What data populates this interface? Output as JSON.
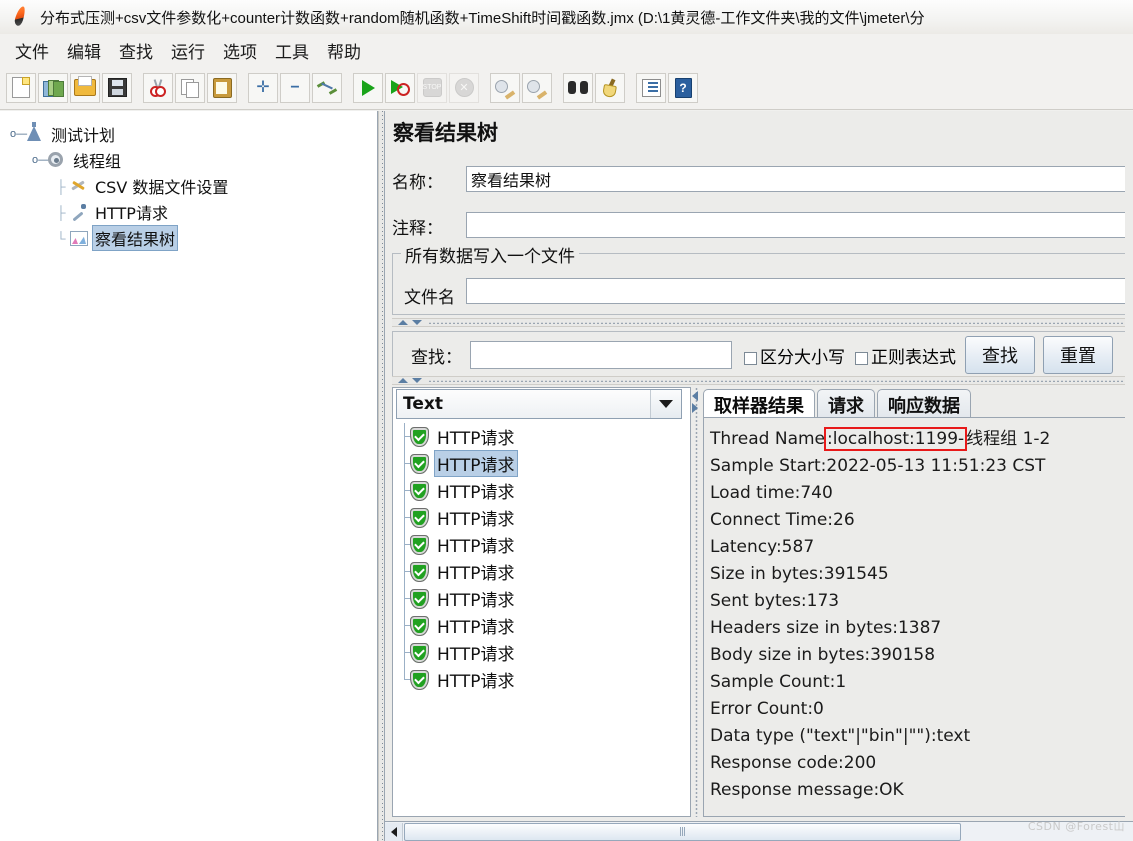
{
  "window": {
    "title": "分布式压测+csv文件参数化+counter计数函数+random随机函数+TimeShift时间戳函数.jmx (D:\\1黄灵德-工作文件夹\\我的文件\\jmeter\\分",
    "app_icon": "jmeter-feather-icon"
  },
  "menubar": {
    "items": [
      {
        "label": "文件",
        "name": "menu-file"
      },
      {
        "label": "编辑",
        "name": "menu-edit"
      },
      {
        "label": "查找",
        "name": "menu-search"
      },
      {
        "label": "运行",
        "name": "menu-run"
      },
      {
        "label": "选项",
        "name": "menu-options"
      },
      {
        "label": "工具",
        "name": "menu-tools"
      },
      {
        "label": "帮助",
        "name": "menu-help"
      }
    ]
  },
  "toolbar": {
    "buttons": [
      {
        "name": "new-icon"
      },
      {
        "name": "templates-icon"
      },
      {
        "name": "open-icon"
      },
      {
        "name": "save-icon"
      },
      {
        "name": "cut-icon"
      },
      {
        "name": "copy-icon"
      },
      {
        "name": "paste-icon"
      },
      {
        "name": "expand-all-icon"
      },
      {
        "name": "collapse-all-icon"
      },
      {
        "name": "toggle-icon"
      },
      {
        "name": "start-icon"
      },
      {
        "name": "start-no-pauses-icon"
      },
      {
        "name": "stop-icon"
      },
      {
        "name": "shutdown-icon"
      },
      {
        "name": "clear-icon"
      },
      {
        "name": "clear-all-icon"
      },
      {
        "name": "search-icon"
      },
      {
        "name": "search-reset-icon"
      },
      {
        "name": "function-helper-icon"
      },
      {
        "name": "help-icon"
      }
    ]
  },
  "tree": {
    "nodes": [
      {
        "label": "测试计划",
        "icon": "flask-icon",
        "depth": 0,
        "selected": false
      },
      {
        "label": "线程组",
        "icon": "gear-icon",
        "depth": 1,
        "selected": false
      },
      {
        "label": "CSV 数据文件设置",
        "icon": "tools-icon",
        "depth": 2,
        "selected": false
      },
      {
        "label": "HTTP请求",
        "icon": "pipette-icon",
        "depth": 2,
        "selected": false
      },
      {
        "label": "察看结果树",
        "icon": "chart-icon",
        "depth": 2,
        "selected": true
      }
    ]
  },
  "panel": {
    "heading": "察看结果树",
    "name_label": "名称：",
    "name_value": "察看结果树",
    "comment_label": "注释：",
    "comment_value": "",
    "group_title": "所有数据写入一个文件",
    "filename_label": "文件名",
    "filename_value": ""
  },
  "search": {
    "label": "查找：",
    "value": "",
    "case_sensitive_label": "区分大小写",
    "case_sensitive_checked": false,
    "regex_label": "正则表达式",
    "regex_checked": false,
    "find_button": "查找",
    "reset_button": "重置"
  },
  "results": {
    "render_selected": "Text",
    "items": [
      {
        "label": "HTTP请求",
        "status": "success",
        "selected": false
      },
      {
        "label": "HTTP请求",
        "status": "success",
        "selected": true
      },
      {
        "label": "HTTP请求",
        "status": "success",
        "selected": false
      },
      {
        "label": "HTTP请求",
        "status": "success",
        "selected": false
      },
      {
        "label": "HTTP请求",
        "status": "success",
        "selected": false
      },
      {
        "label": "HTTP请求",
        "status": "success",
        "selected": false
      },
      {
        "label": "HTTP请求",
        "status": "success",
        "selected": false
      },
      {
        "label": "HTTP请求",
        "status": "success",
        "selected": false
      },
      {
        "label": "HTTP请求",
        "status": "success",
        "selected": false
      },
      {
        "label": "HTTP请求",
        "status": "success",
        "selected": false
      }
    ]
  },
  "tabs": [
    {
      "label": "取样器结果",
      "active": true
    },
    {
      "label": "请求",
      "active": false
    },
    {
      "label": "响应数据",
      "active": false
    }
  ],
  "sampler_result": {
    "thread_name_prefix": "Thread Name",
    "thread_name_highlight": ":localhost:1199-",
    "thread_name_suffix": "线程组 1-2",
    "lines": [
      "Sample Start:2022-05-13 11:51:23 CST",
      "Load time:740",
      "Connect Time:26",
      "Latency:587",
      "Size in bytes:391545",
      "Sent bytes:173",
      "Headers size in bytes:1387",
      "Body size in bytes:390158",
      "Sample Count:1",
      "Error Count:0",
      "Data type (\"text\"|\"bin\"|\"\"):text",
      "Response code:200",
      "Response message:OK"
    ],
    "highlight_color": "#e81919"
  },
  "watermark": "CSDN @Forest山"
}
